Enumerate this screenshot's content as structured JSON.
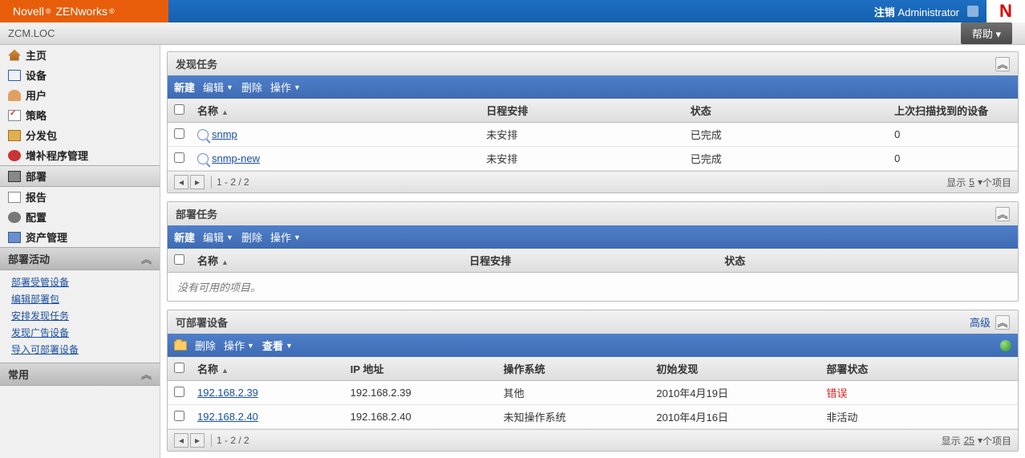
{
  "brand": {
    "part1": "Novell",
    "part2": "ZENworks"
  },
  "topbar": {
    "logout": "注销",
    "user": "Administrator"
  },
  "breadcrumb": "ZCM.LOC",
  "help_label": "帮助",
  "nlogo": "N",
  "nav": [
    {
      "label": "主页"
    },
    {
      "label": "设备"
    },
    {
      "label": "用户"
    },
    {
      "label": "策略"
    },
    {
      "label": "分发包"
    },
    {
      "label": "增补程序管理"
    },
    {
      "label": "部署"
    },
    {
      "label": "报告"
    },
    {
      "label": "配置"
    },
    {
      "label": "资产管理"
    }
  ],
  "section_activities": {
    "title": "部署活动",
    "items": [
      "部署受管设备",
      "编辑部署包",
      "安排发现任务",
      "发现广告设备",
      "导入可部署设备"
    ]
  },
  "section_common": {
    "title": "常用"
  },
  "panels": {
    "discovery": {
      "title": "发现任务",
      "toolbar": {
        "new": "新建",
        "edit": "编辑",
        "delete": "删除",
        "action": "操作"
      },
      "cols": {
        "name": "名称",
        "schedule": "日程安排",
        "status": "状态",
        "lastscan": "上次扫描找到的设备"
      },
      "rows": [
        {
          "name": "snmp",
          "schedule": "未安排",
          "status": "已完成",
          "lastscan": "0"
        },
        {
          "name": "snmp-new",
          "schedule": "未安排",
          "status": "已完成",
          "lastscan": "0"
        }
      ],
      "pager": {
        "range": "1 - 2 / 2",
        "show": "显示",
        "count": "5",
        "suffix": "个项目"
      }
    },
    "deploytask": {
      "title": "部署任务",
      "toolbar": {
        "new": "新建",
        "edit": "编辑",
        "delete": "删除",
        "action": "操作"
      },
      "cols": {
        "name": "名称",
        "schedule": "日程安排",
        "status": "状态"
      },
      "empty": "没有可用的项目。"
    },
    "deployable": {
      "title": "可部署设备",
      "advanced": "高级",
      "toolbar": {
        "delete": "删除",
        "action": "操作",
        "view": "查看"
      },
      "cols": {
        "name": "名称",
        "ip": "IP 地址",
        "os": "操作系统",
        "initial": "初始发现",
        "status": "部署状态"
      },
      "rows": [
        {
          "name": "192.168.2.39",
          "ip": "192.168.2.39",
          "os": "其他",
          "initial": "2010年4月19日",
          "status": "错误",
          "err": true
        },
        {
          "name": "192.168.2.40",
          "ip": "192.168.2.40",
          "os": "未知操作系统",
          "initial": "2010年4月16日",
          "status": "非活动"
        }
      ],
      "pager": {
        "range": "1 - 2 / 2",
        "show": "显示",
        "count": "25",
        "suffix": "个项目"
      }
    }
  }
}
